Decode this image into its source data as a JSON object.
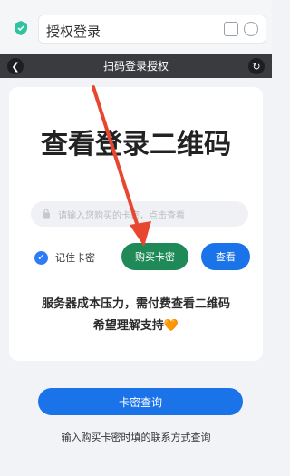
{
  "topbar": {
    "title": "授权登录"
  },
  "navbar": {
    "title": "扫码登录授权"
  },
  "card": {
    "headline": "查看登录二维码",
    "input_placeholder": "请输入您购买的卡密，点击查看",
    "remember_label": "记住卡密",
    "buy_button": "购买卡密",
    "view_button": "查看",
    "notice_line1": "服务器成本压力，需付费查看二维码",
    "notice_line2": "希望理解支持",
    "notice_heart": "🧡"
  },
  "footer": {
    "query_button": "卡密查询",
    "hint": "输入购买卡密时填的联系方式查询"
  },
  "colors": {
    "blue": "#1a73e8",
    "green": "#1f8a57",
    "arrow_red": "#e8472f"
  }
}
